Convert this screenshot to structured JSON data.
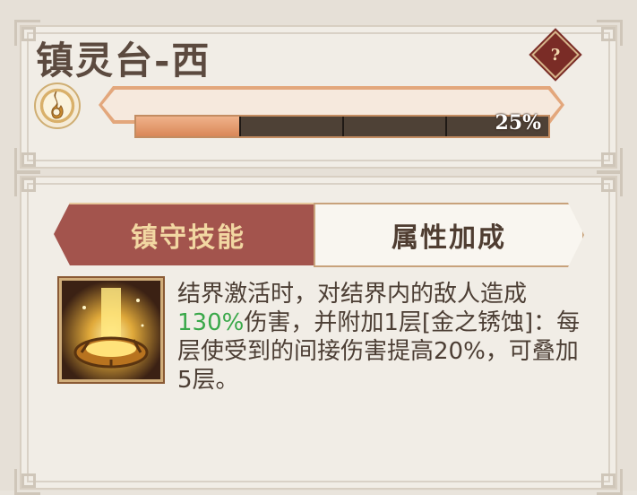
{
  "panel": {
    "title": "镇灵台-西",
    "help_label": "?"
  },
  "progress": {
    "percent": 25,
    "percent_label": "25%",
    "segments": 4
  },
  "tabs": [
    {
      "label": "镇守技能",
      "active": true
    },
    {
      "label": "属性加成",
      "active": false
    }
  ],
  "skill": {
    "icon": "golden-pillar-skill-icon",
    "desc_part1": "结界激活时，对结界内的敌人造成",
    "desc_highlight": "130%",
    "desc_part2": "伤害，并附加1层[金之锈蚀]：每层使受到的间接伤害提高20%，可叠加5层。"
  },
  "colors": {
    "highlight": "#3aa84a",
    "tab_active": "#a3544d",
    "bar_fill": "#e09d70"
  }
}
